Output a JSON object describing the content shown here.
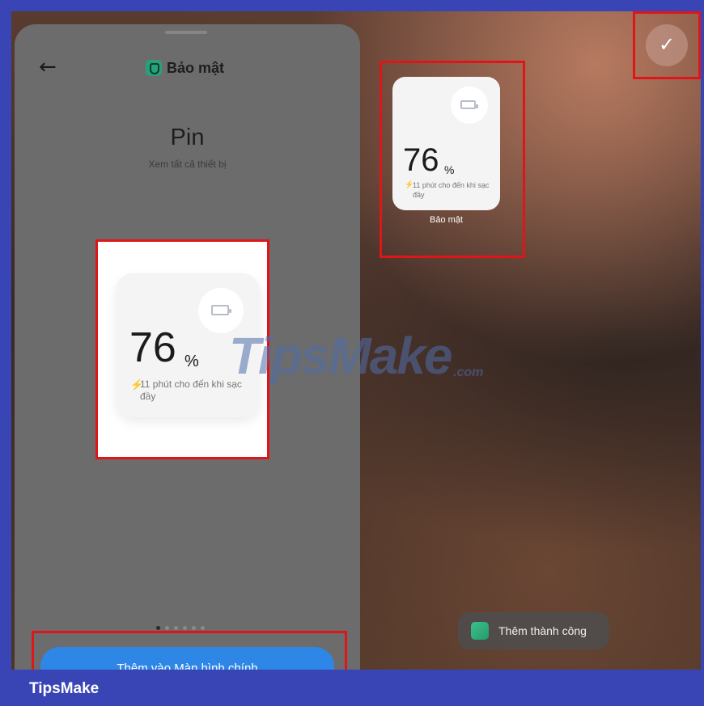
{
  "header": {
    "back_icon": "arrow-left-icon",
    "app_title": "Bảo mật",
    "app_icon": "shield-app-icon"
  },
  "widget": {
    "name": "Pin",
    "subtitle": "Xem tất cả thiết bị",
    "percent": "76",
    "percent_unit": "%",
    "charge_text": "11 phút cho đến khi sạc đầy",
    "battery_icon": "battery-icon",
    "bolt_icon": "charging-bolt-icon"
  },
  "home_widget": {
    "percent": "76",
    "percent_unit": "%",
    "charge_text": "11 phút cho đến khi sạc đầy",
    "label": "Bảo mật"
  },
  "actions": {
    "add_button": "Thêm vào Màn hình chính",
    "confirm_icon": "check-icon"
  },
  "pagination": {
    "count": 6,
    "active_index": 0
  },
  "toast": {
    "text": "Thêm thành công"
  },
  "watermark": {
    "text": "TipsMake",
    "suffix": ".com"
  },
  "footer": {
    "brand": "TipsMake"
  },
  "colors": {
    "highlight": "#e0151a",
    "brand_blue": "#3a45b5",
    "button_blue": "#2e87e6",
    "charge_green": "#34b04a"
  }
}
